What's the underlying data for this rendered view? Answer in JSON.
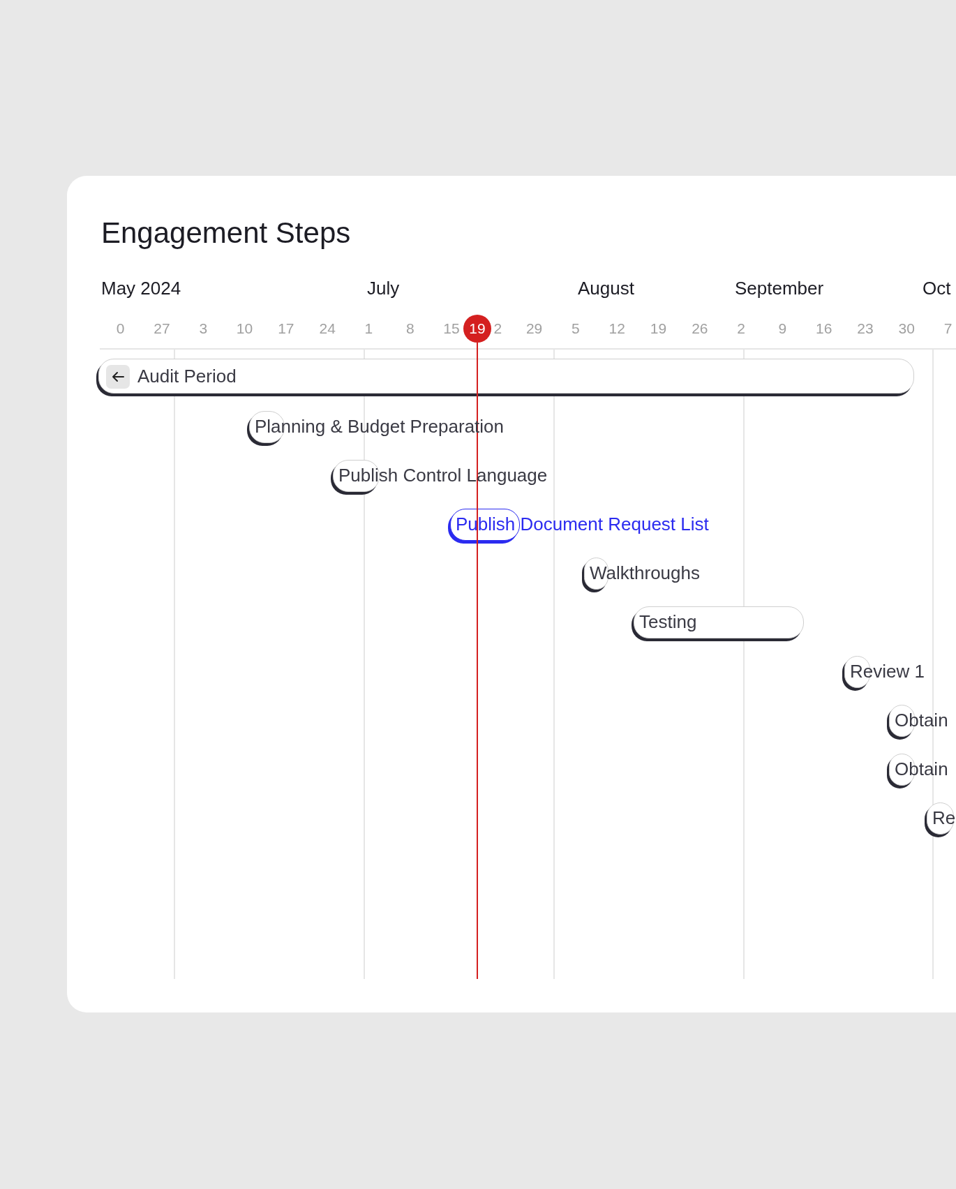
{
  "title": "Engagement Steps",
  "months": [
    "May 2024",
    "July",
    "August",
    "September",
    "Oct"
  ],
  "weeks": [
    "0",
    "27",
    "3",
    "10",
    "17",
    "24",
    "1",
    "8",
    "15",
    "2",
    "29",
    "5",
    "12",
    "19",
    "26",
    "2",
    "9",
    "16",
    "23",
    "30",
    "7"
  ],
  "today": {
    "label": "19"
  },
  "steps": [
    {
      "label": "Audit Period",
      "kind": "group",
      "selected": false
    },
    {
      "label": "Planning & Budget Preparation",
      "kind": "step",
      "selected": false
    },
    {
      "label": "Publish Control Language",
      "kind": "step",
      "selected": false
    },
    {
      "label": "Publish Document Request List",
      "kind": "step",
      "selected": true
    },
    {
      "label": "Walkthroughs",
      "kind": "step",
      "selected": false
    },
    {
      "label": "Testing",
      "kind": "step",
      "selected": false
    },
    {
      "label": "Review 1",
      "kind": "step",
      "selected": false
    },
    {
      "label": "Obtain",
      "kind": "step",
      "selected": false
    },
    {
      "label": "Obtain",
      "kind": "step",
      "selected": false
    },
    {
      "label": "Re",
      "kind": "step",
      "selected": false
    }
  ]
}
